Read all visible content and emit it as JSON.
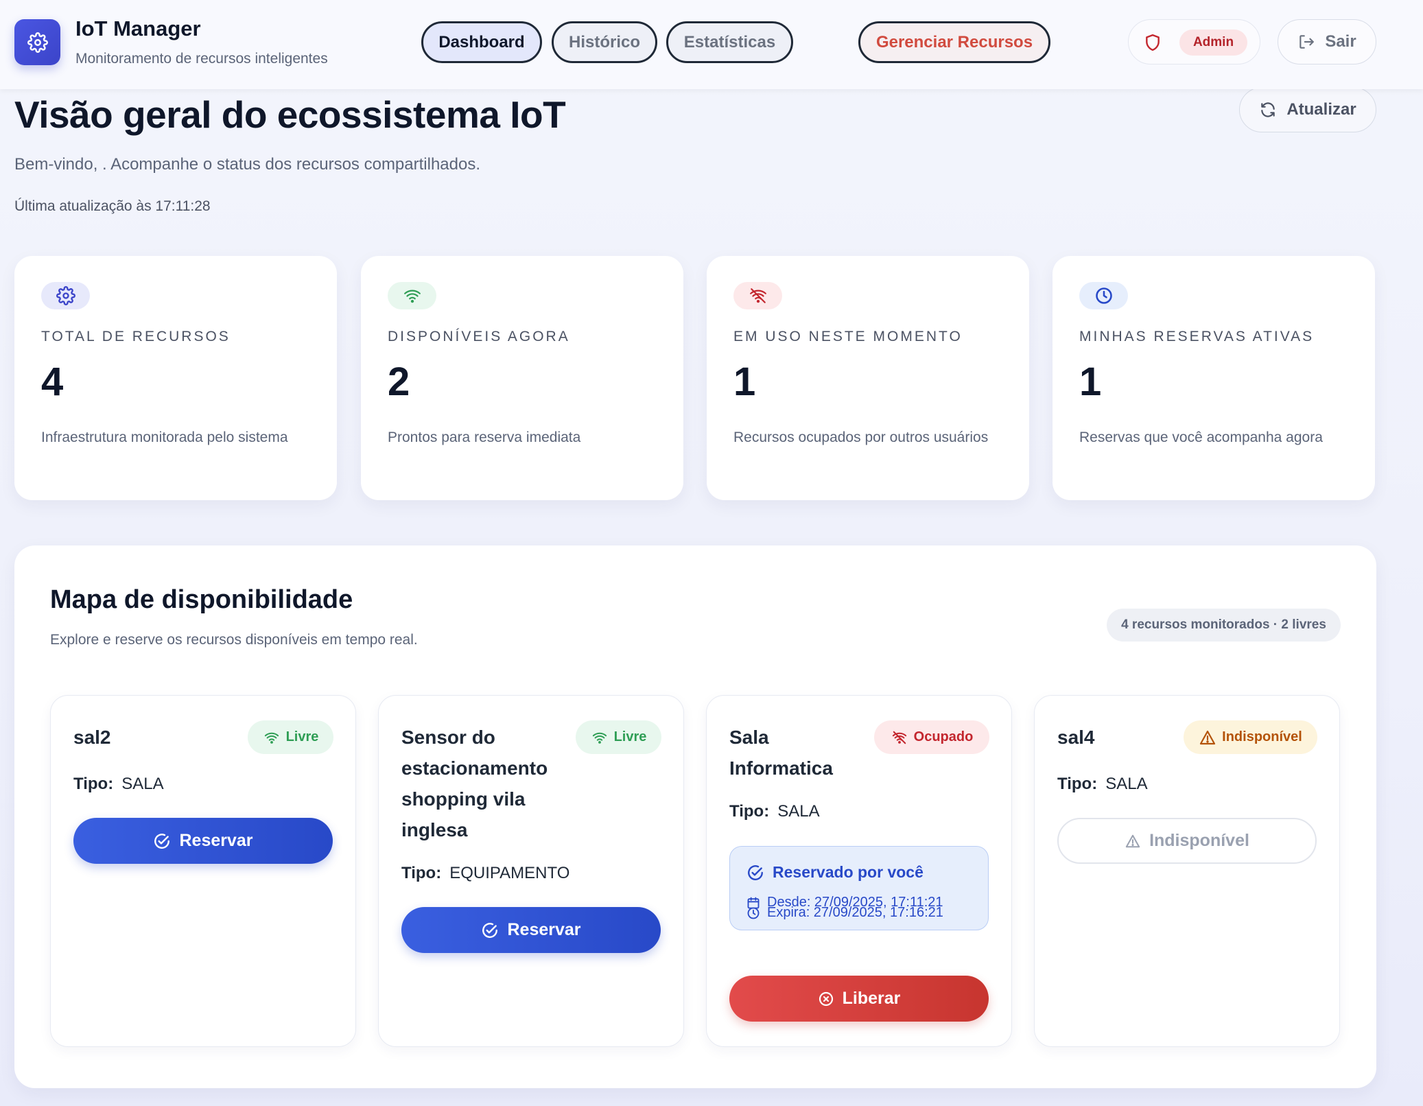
{
  "header": {
    "app_title": "IoT Manager",
    "app_subtitle": "Monitoramento de recursos inteligentes",
    "tabs": [
      {
        "label": "Dashboard",
        "active": true
      },
      {
        "label": "Histórico",
        "active": false
      },
      {
        "label": "Estatísticas",
        "active": false
      }
    ],
    "manage_label": "Gerenciar Recursos",
    "role_badge": "Admin",
    "logout_label": "Sair"
  },
  "page": {
    "title": "Visão geral do ecossistema IoT",
    "welcome": "Bem-vindo, . Acompanhe o status dos recursos compartilhados.",
    "last_update": "Última atualização às 17:11:28",
    "refresh_label": "Atualizar"
  },
  "stats": [
    {
      "icon": "gear-icon",
      "label": "TOTAL DE RECURSOS",
      "value": "4",
      "desc": "Infraestrutura monitorada pelo sistema",
      "color": "#3b44c9",
      "bg": "#e7e9fb"
    },
    {
      "icon": "wifi-icon",
      "label": "DISPONÍVEIS AGORA",
      "value": "2",
      "desc": "Prontos para reserva imediata",
      "color": "#2f9e55",
      "bg": "#e8f7ee"
    },
    {
      "icon": "wifi-off-icon",
      "label": "EM USO NESTE MOMENTO",
      "value": "1",
      "desc": "Recursos ocupados por outros usuários",
      "color": "#c3262e",
      "bg": "#fde9ea"
    },
    {
      "icon": "clock-icon",
      "label": "MINHAS RESERVAS ATIVAS",
      "value": "1",
      "desc": "Reservas que você acompanha agora",
      "color": "#2849c8",
      "bg": "#e6eefc"
    }
  ],
  "availability": {
    "title": "Mapa de disponibilidade",
    "subtitle": "Explore e reserve os recursos disponíveis em tempo real.",
    "counter": "4 recursos monitorados · 2 livres",
    "type_key": "Tipo:",
    "resources": [
      {
        "name": "sal2",
        "type": "SALA",
        "status": "Livre",
        "action": "Reservar"
      },
      {
        "name": "Sensor do estacionamento shopping vila inglesa",
        "type": "EQUIPAMENTO",
        "status": "Livre",
        "action": "Reservar"
      },
      {
        "name": "Sala Informatica",
        "type": "SALA",
        "status": "Ocupado",
        "action": "Liberar",
        "reservation": {
          "title": "Reservado por você",
          "since": "Desde: 27/09/2025, 17:11:21",
          "expires": "Expira: 27/09/2025, 17:16:21"
        }
      },
      {
        "name": "sal4",
        "type": "SALA",
        "status": "Indisponível",
        "action": "Indisponível"
      }
    ]
  },
  "colors": {
    "primary": "#2849c8",
    "success": "#2f9e55",
    "danger": "#c3262e",
    "warning": "#b45309"
  }
}
